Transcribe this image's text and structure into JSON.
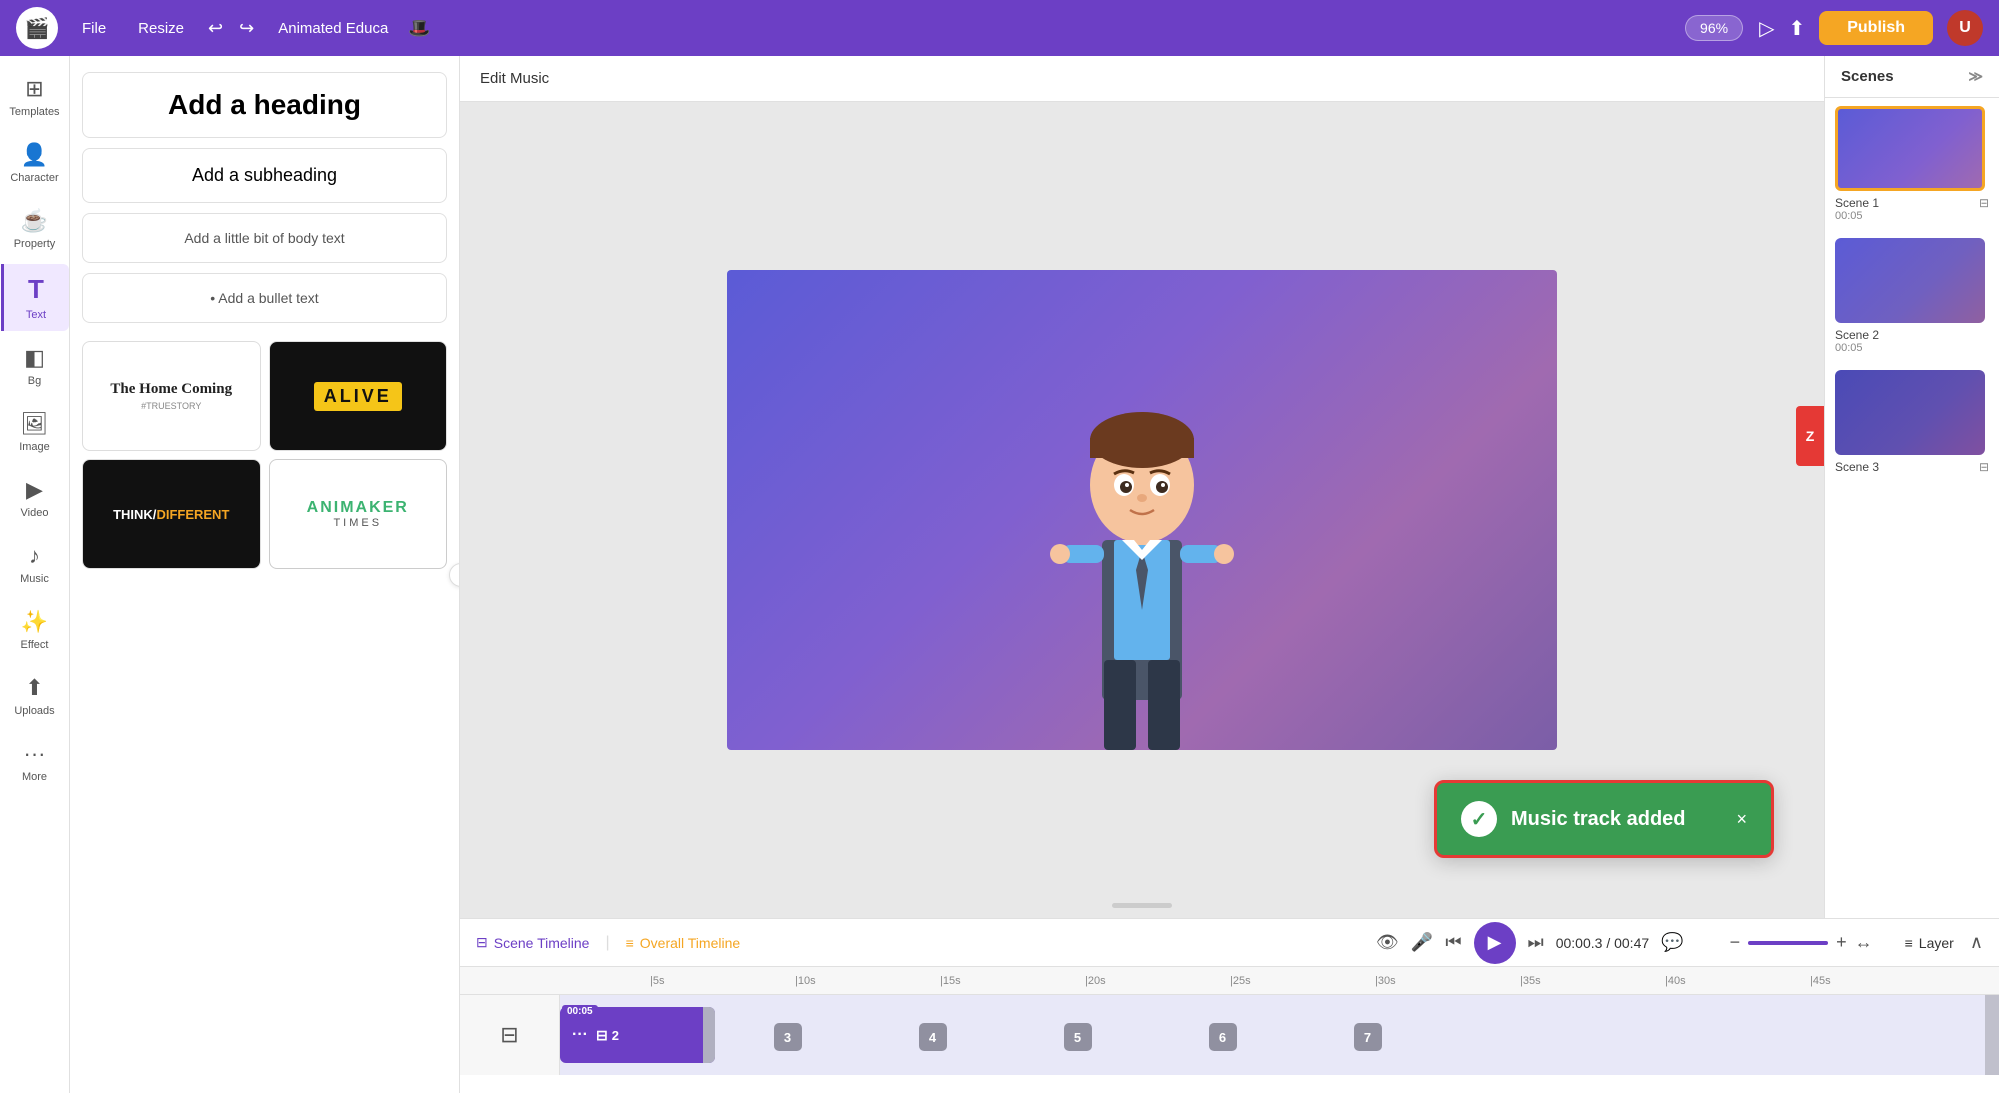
{
  "topbar": {
    "logo_text": "🎬",
    "file_label": "File",
    "resize_label": "Resize",
    "undo_icon": "↩",
    "redo_icon": "↪",
    "project_name": "Animated Educa",
    "project_emoji": "🎩",
    "zoom_level": "96%",
    "publish_label": "Publish",
    "play_icon": "▷",
    "share_icon": "⬆"
  },
  "sidebar": {
    "items": [
      {
        "id": "templates",
        "label": "Templates",
        "icon": "⊞"
      },
      {
        "id": "character",
        "label": "Character",
        "icon": "👤"
      },
      {
        "id": "property",
        "label": "Property",
        "icon": "☕"
      },
      {
        "id": "text",
        "label": "Text",
        "icon": "T",
        "active": true
      },
      {
        "id": "bg",
        "label": "Bg",
        "icon": "◧"
      },
      {
        "id": "image",
        "label": "Image",
        "icon": "🖼"
      },
      {
        "id": "video",
        "label": "Video",
        "icon": "▶"
      },
      {
        "id": "music",
        "label": "Music",
        "icon": "♪"
      },
      {
        "id": "effect",
        "label": "Effect",
        "icon": "✨"
      },
      {
        "id": "uploads",
        "label": "Uploads",
        "icon": "⬆"
      },
      {
        "id": "more",
        "label": "More",
        "icon": "···"
      }
    ]
  },
  "text_panel": {
    "cards": [
      {
        "id": "heading",
        "type": "heading",
        "label": "Add a heading"
      },
      {
        "id": "subheading",
        "type": "subheading",
        "label": "Add a subheading"
      },
      {
        "id": "body",
        "type": "body",
        "label": "Add a little bit of body text"
      },
      {
        "id": "bullet",
        "type": "bullet",
        "label": "• Add a bullet text"
      }
    ],
    "templates": [
      {
        "id": "tpl1",
        "name": "The Home Coming",
        "subtitle": "#TRUESTORY",
        "style": "dark-light"
      },
      {
        "id": "tpl2",
        "name": "ALIVE",
        "style": "dark-yellow"
      },
      {
        "id": "tpl3",
        "name": "THINK/DIFFERENT",
        "style": "dark-text"
      },
      {
        "id": "tpl4",
        "name": "ANIMAKER TIMES",
        "style": "green-text"
      }
    ]
  },
  "canvas": {
    "edit_music_label": "Edit Music"
  },
  "toast": {
    "message": "Music track added",
    "check_icon": "✓",
    "close_icon": "×"
  },
  "scenes": {
    "header": "Scenes",
    "items": [
      {
        "id": "scene1",
        "label": "Scene 1",
        "time": "00:05",
        "active": true
      },
      {
        "id": "scene2",
        "label": "Scene 2",
        "time": "00:05",
        "active": false
      },
      {
        "id": "scene3",
        "label": "Scene 3",
        "time": "",
        "active": false
      }
    ]
  },
  "timeline": {
    "scene_tab_label": "Scene Timeline",
    "overall_tab_label": "Overall Timeline",
    "current_time": "00:00.3",
    "total_time": "00:47",
    "play_icon": "▶",
    "prev_icon": "⏮",
    "next_icon": "⏭",
    "mic_icon": "🎤",
    "eye_icon": "👁",
    "subtitle_icon": "💬",
    "zoom_minus": "−",
    "zoom_plus": "+",
    "expand_icon": "↔",
    "layer_label": "Layer",
    "collapse_icon": "∧",
    "clip_time": "00:05",
    "ruler_ticks": [
      "5s",
      "10s",
      "15s",
      "20s",
      "25s",
      "30s",
      "35s",
      "40s",
      "45s"
    ],
    "track_numbers": [
      "2",
      "3",
      "4",
      "5",
      "6",
      "7"
    ]
  }
}
